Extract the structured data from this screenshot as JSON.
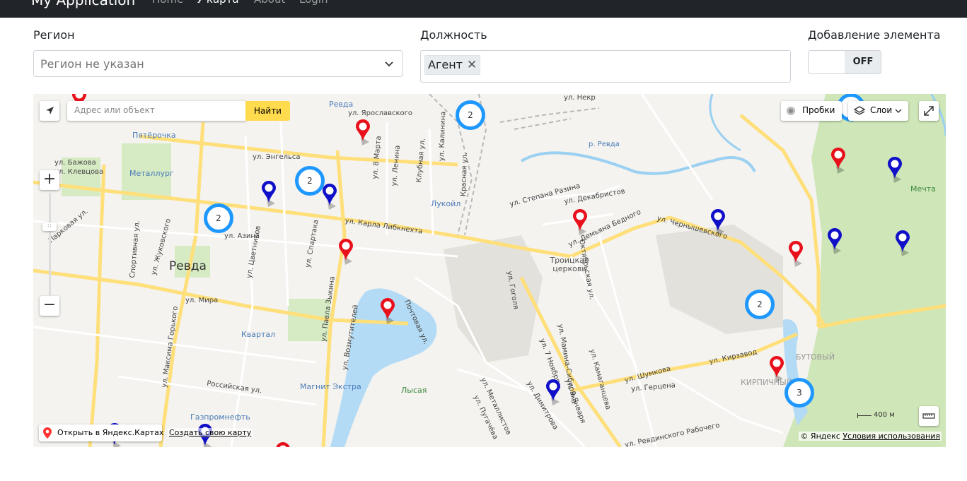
{
  "navbar": {
    "brand": "My Application",
    "links": [
      "Home",
      "У карта",
      "About",
      "Login"
    ]
  },
  "filters": {
    "region_label": "Регион",
    "region_placeholder": "Регион не указан",
    "position_label": "Должность",
    "position_chip": "Агент",
    "chip_remove": "✕",
    "add_label": "Добавление элемента",
    "toggle_state": "OFF"
  },
  "map": {
    "search_placeholder": "Адрес или объект",
    "search_button": "Найти",
    "traffic_button": "Пробки",
    "layers_button": "Слои",
    "zoom_in": "+",
    "zoom_out": "−",
    "scale": "400 м",
    "open_in_yandex": "Открыть в Яндекс.Картах",
    "create_map": "Создать свою карту",
    "copyright": "© Яндекс",
    "terms": "Условия использования",
    "city": "Ревда",
    "places": [
      "Металлург",
      "Пятёрочка",
      "Лукойл",
      "Троицкая церковь",
      "Квартал",
      "Магнит Экстра",
      "Газпромнефть",
      "Лысая",
      "Мечта",
      "БУТОВЫЙ",
      "КИРПИЧНЫЙ",
      "р. Ревда",
      "Ревда"
    ],
    "streets": [
      "ул. Ярославского",
      "ул. Энгельса",
      "ул. Бажова",
      "ул. Клевцова",
      "ул. Карла Либкнехта",
      "ул. Азина",
      "ул. Мира",
      "ул. Цветников",
      "ул. Спартака",
      "ул. Павла Зыкина",
      "ул. Возмутителей",
      "Почтовая ул.",
      "ул. Жуковского",
      "Спортивная ул.",
      "ул. Максима Горького",
      "Российская ул.",
      "ул. Чернышевского",
      "ул. Кирзавод",
      "ул. Герцена",
      "ул. Шумкова",
      "ул. Гоголя",
      "ул. Мамина-Сибиряка",
      "ул. Декабристов",
      "ул. Степана Разина",
      "ул. Демьяна Бедного",
      "Октябрьская ул.",
      "ул. 7 Ноября",
      "ул. Димитрова",
      "ул. Металлистов",
      "ул. Пугачёва",
      "ул. Камаганцева",
      "ул. Ревдинского Рабочего",
      "ул. Некр",
      "ул. Ленина",
      "ул. 8 Марта",
      "Клубная ул.",
      "ул. Калинина",
      "Красная ул.",
      "Парковая ул.",
      "ул. 9 Января"
    ],
    "clusters": [
      "2",
      "2",
      "2",
      "2",
      "3"
    ]
  }
}
